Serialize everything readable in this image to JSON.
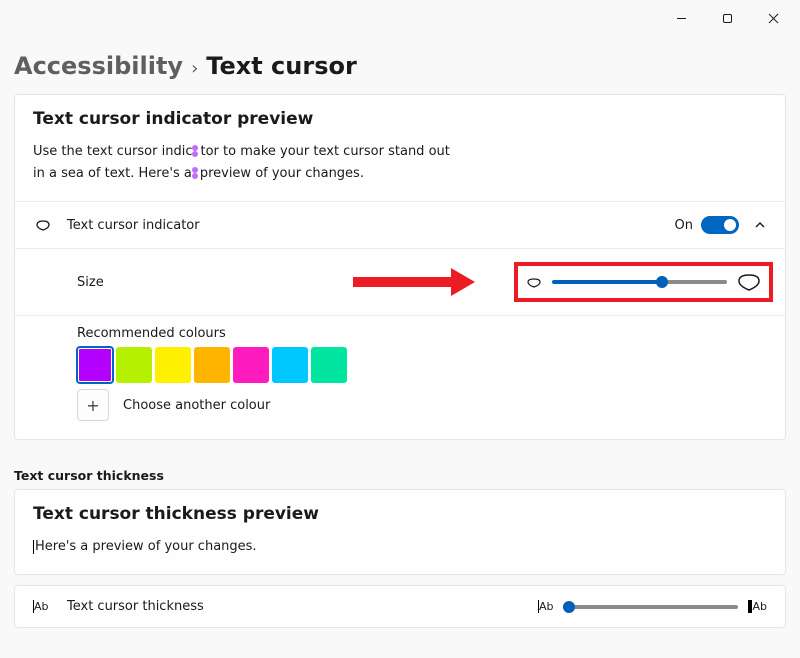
{
  "window": {
    "controls": [
      "minimize",
      "maximize",
      "close"
    ]
  },
  "breadcrumb": {
    "parent": "Accessibility",
    "separator": "›",
    "current": "Text cursor"
  },
  "indicator_card": {
    "preview_title": "Text cursor indicator preview",
    "preview_line1a": "Use the text cursor indic",
    "preview_line1b": "tor to make your text cursor stand out",
    "preview_line2a": "in a sea of text. Here's a",
    "preview_line2b": "preview of your changes.",
    "toggle_row": {
      "label": "Text cursor indicator",
      "state_label": "On",
      "state": true
    },
    "size_row": {
      "label": "Size",
      "value_percent": 63
    },
    "colors": {
      "heading": "Recommended colours",
      "swatches": [
        {
          "name": "purple",
          "hex": "#b400ff",
          "selected": true
        },
        {
          "name": "lime",
          "hex": "#b4f000"
        },
        {
          "name": "yellow",
          "hex": "#fff000"
        },
        {
          "name": "orange",
          "hex": "#ffb400"
        },
        {
          "name": "magenta",
          "hex": "#ff1cbe"
        },
        {
          "name": "cyan",
          "hex": "#00c8ff"
        },
        {
          "name": "teal",
          "hex": "#00e6a0"
        }
      ],
      "choose_another_label": "Choose another colour"
    }
  },
  "thickness_section": {
    "section_label": "Text cursor thickness",
    "preview_title": "Text cursor thickness preview",
    "preview_text": "Here's a preview of your changes.",
    "slider_row": {
      "label": "Text cursor thickness",
      "small_icon_text": "Ab",
      "big_icon_text": "Ab",
      "value_percent": 2
    }
  },
  "annotation": {
    "highlight_target": "size-slider"
  }
}
